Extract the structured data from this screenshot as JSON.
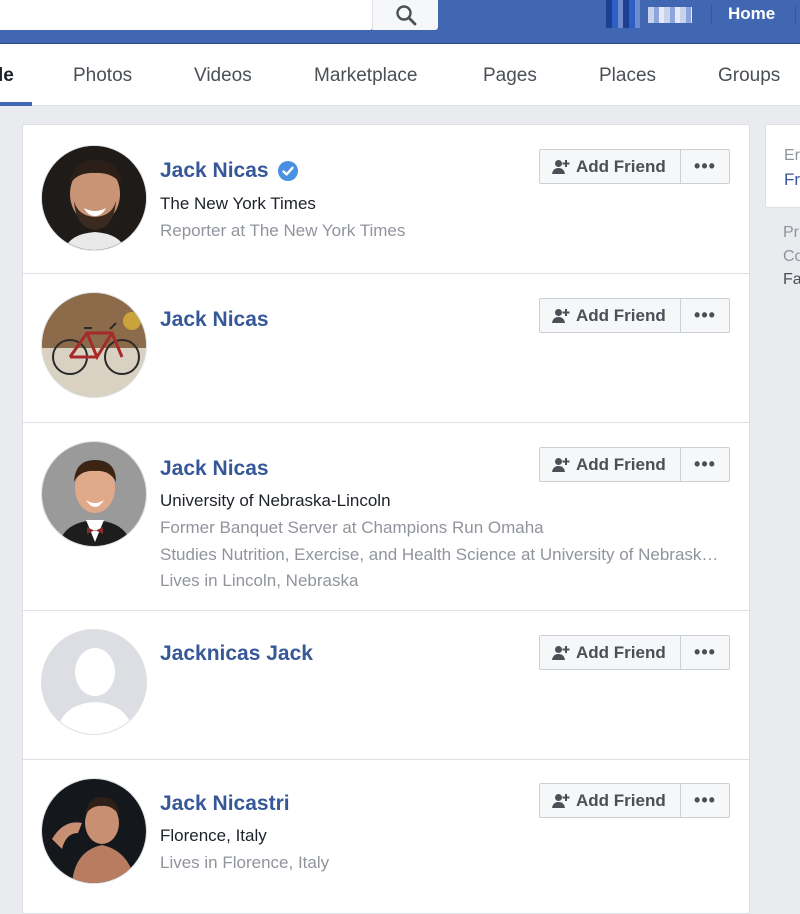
{
  "header": {
    "home_label": "Home",
    "search_icon": "magnifier-icon"
  },
  "tabs": [
    {
      "label": "le",
      "active": true
    },
    {
      "label": "Photos"
    },
    {
      "label": "Videos"
    },
    {
      "label": "Marketplace"
    },
    {
      "label": "Pages"
    },
    {
      "label": "Places"
    },
    {
      "label": "Groups"
    }
  ],
  "results": [
    {
      "name": "Jack Nicas",
      "verified": true,
      "line1": "The New York Times",
      "lines": [
        "Reporter at The New York Times"
      ],
      "photo": "man-smiling-beard"
    },
    {
      "name": "Jack Nicas",
      "verified": false,
      "line1": "",
      "lines": [],
      "photo": "bicycle"
    },
    {
      "name": "Jack Nicas",
      "verified": false,
      "line1": "University of Nebraska-Lincoln",
      "lines": [
        "Former Banquet Server at Champions Run Omaha",
        "Studies Nutrition, Exercise, and Health Science at University of Nebraska-Lincoln",
        "Lives in Lincoln, Nebraska"
      ],
      "photo": "young-man-bowtie"
    },
    {
      "name": "Jacknicas Jack",
      "verified": false,
      "line1": "",
      "lines": [],
      "photo": "default-silhouette"
    },
    {
      "name": "Jack Nicastri",
      "verified": false,
      "line1": "Florence, Italy",
      "lines": [
        "Lives in Florence, Italy"
      ],
      "photo": "shirtless-man"
    }
  ],
  "buttons": {
    "add_friend": "Add Friend",
    "more": "•••"
  },
  "right_panel": {
    "card_line1": "Er",
    "card_line2": "Fr",
    "side_lines": [
      "Pr",
      "Co",
      "Fa"
    ]
  },
  "colors": {
    "brand_blue": "#4267b2",
    "link_blue": "#365899",
    "verified_blue": "#4a90e2",
    "page_bg": "#e9ebee"
  }
}
